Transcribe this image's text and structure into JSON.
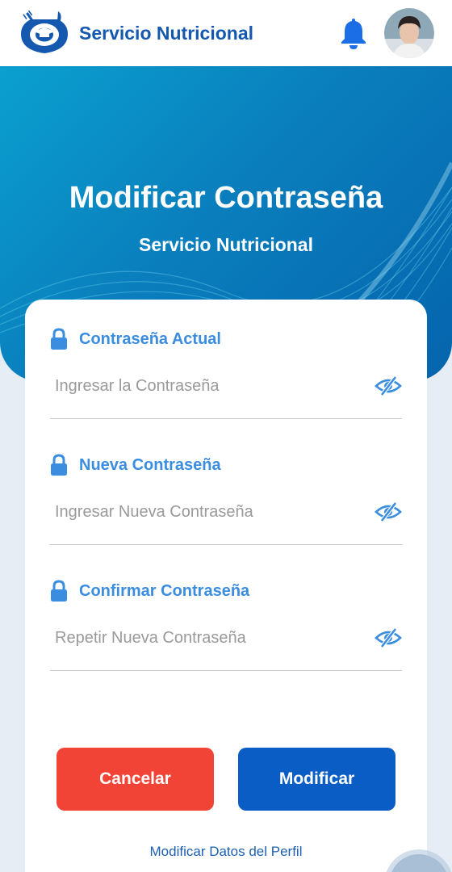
{
  "header": {
    "app_name": "Servicio Nutricional",
    "logo_icon": "servicio-nutricional-logo",
    "bell_icon": "notification-bell-icon",
    "avatar": "user-avatar"
  },
  "hero": {
    "title": "Modificar Contraseña",
    "subtitle": "Servicio Nutricional"
  },
  "form": {
    "fields": [
      {
        "label": "Contraseña Actual",
        "placeholder": "Ingresar la Contraseña",
        "value": "",
        "icon": "lock-icon",
        "toggle_icon": "eye-slash-icon"
      },
      {
        "label": "Nueva Contraseña",
        "placeholder": "Ingresar Nueva Contraseña",
        "value": "",
        "icon": "lock-icon",
        "toggle_icon": "eye-slash-icon"
      },
      {
        "label": "Confirmar Contraseña",
        "placeholder": "Repetir Nueva Contraseña",
        "value": "",
        "icon": "lock-icon",
        "toggle_icon": "eye-slash-icon"
      }
    ],
    "cancel_label": "Cancelar",
    "submit_label": "Modificar",
    "profile_link": "Modificar Datos del Perfil"
  },
  "colors": {
    "brand_blue": "#1558b0",
    "label_blue": "#3b8de0",
    "hero_start": "#0aa0cf",
    "hero_end": "#0564ad",
    "cancel_red": "#f24436",
    "submit_blue": "#0a5dc4",
    "background": "#e6edf4"
  }
}
